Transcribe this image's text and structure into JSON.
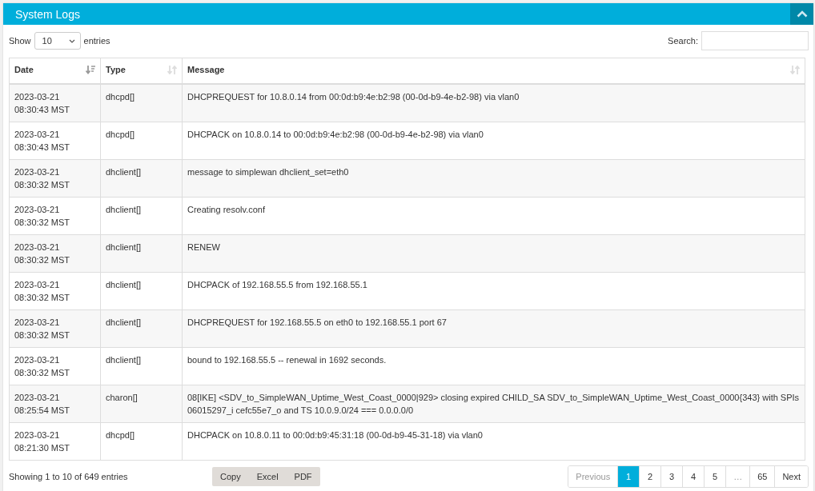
{
  "panel": {
    "title": "System Logs",
    "expanded": true
  },
  "length_control": {
    "label_before": "Show",
    "value": "10",
    "label_after": "entries"
  },
  "search": {
    "label": "Search:"
  },
  "table": {
    "columns": [
      {
        "label": "Date",
        "sorted": true
      },
      {
        "label": "Type",
        "sorted": false
      },
      {
        "label": "Message",
        "sorted": false
      }
    ],
    "rows": [
      {
        "date": "2023-03-21",
        "time": "08:30:43 MST",
        "type": "dhcpd[]",
        "message": "DHCPREQUEST for 10.8.0.14 from 00:0d:b9:4e:b2:98 (00-0d-b9-4e-b2-98) via vlan0"
      },
      {
        "date": "2023-03-21",
        "time": "08:30:43 MST",
        "type": "dhcpd[]",
        "message": "DHCPACK on 10.8.0.14 to 00:0d:b9:4e:b2:98 (00-0d-b9-4e-b2-98) via vlan0"
      },
      {
        "date": "2023-03-21",
        "time": "08:30:32 MST",
        "type": "dhclient[]",
        "message": "message to simplewan dhclient_set=eth0"
      },
      {
        "date": "2023-03-21",
        "time": "08:30:32 MST",
        "type": "dhclient[]",
        "message": "Creating resolv.conf"
      },
      {
        "date": "2023-03-21",
        "time": "08:30:32 MST",
        "type": "dhclient[]",
        "message": "RENEW"
      },
      {
        "date": "2023-03-21",
        "time": "08:30:32 MST",
        "type": "dhclient[]",
        "message": "DHCPACK of 192.168.55.5 from 192.168.55.1"
      },
      {
        "date": "2023-03-21",
        "time": "08:30:32 MST",
        "type": "dhclient[]",
        "message": "DHCPREQUEST for 192.168.55.5 on eth0 to 192.168.55.1 port 67"
      },
      {
        "date": "2023-03-21",
        "time": "08:30:32 MST",
        "type": "dhclient[]",
        "message": "bound to 192.168.55.5 -- renewal in 1692 seconds."
      },
      {
        "date": "2023-03-21",
        "time": "08:25:54 MST",
        "type": "charon[]",
        "message": "08[IKE] <SDV_to_SimpleWAN_Uptime_West_Coast_0000|929> closing expired CHILD_SA SDV_to_SimpleWAN_Uptime_West_Coast_0000{343} with SPIs 06015297_i cefc55e7_o and TS 10.0.9.0/24 === 0.0.0.0/0"
      },
      {
        "date": "2023-03-21",
        "time": "08:21:30 MST",
        "type": "dhcpd[]",
        "message": "DHCPACK on 10.8.0.11 to 00:0d:b9:45:31:18 (00-0d-b9-45-31-18) via vlan0"
      }
    ]
  },
  "info": "Showing 1 to 10 of 649 entries",
  "export_buttons": [
    "Copy",
    "Excel",
    "PDF"
  ],
  "pagination": [
    {
      "label": "Previous",
      "selected": false,
      "disabled": true
    },
    {
      "label": "1",
      "selected": true,
      "disabled": false
    },
    {
      "label": "2",
      "selected": false,
      "disabled": false
    },
    {
      "label": "3",
      "selected": false,
      "disabled": false
    },
    {
      "label": "4",
      "selected": false,
      "disabled": false
    },
    {
      "label": "5",
      "selected": false,
      "disabled": false
    },
    {
      "label": "…",
      "selected": false,
      "disabled": true
    },
    {
      "label": "65",
      "selected": false,
      "disabled": false
    },
    {
      "label": "Next",
      "selected": false,
      "disabled": false
    }
  ]
}
